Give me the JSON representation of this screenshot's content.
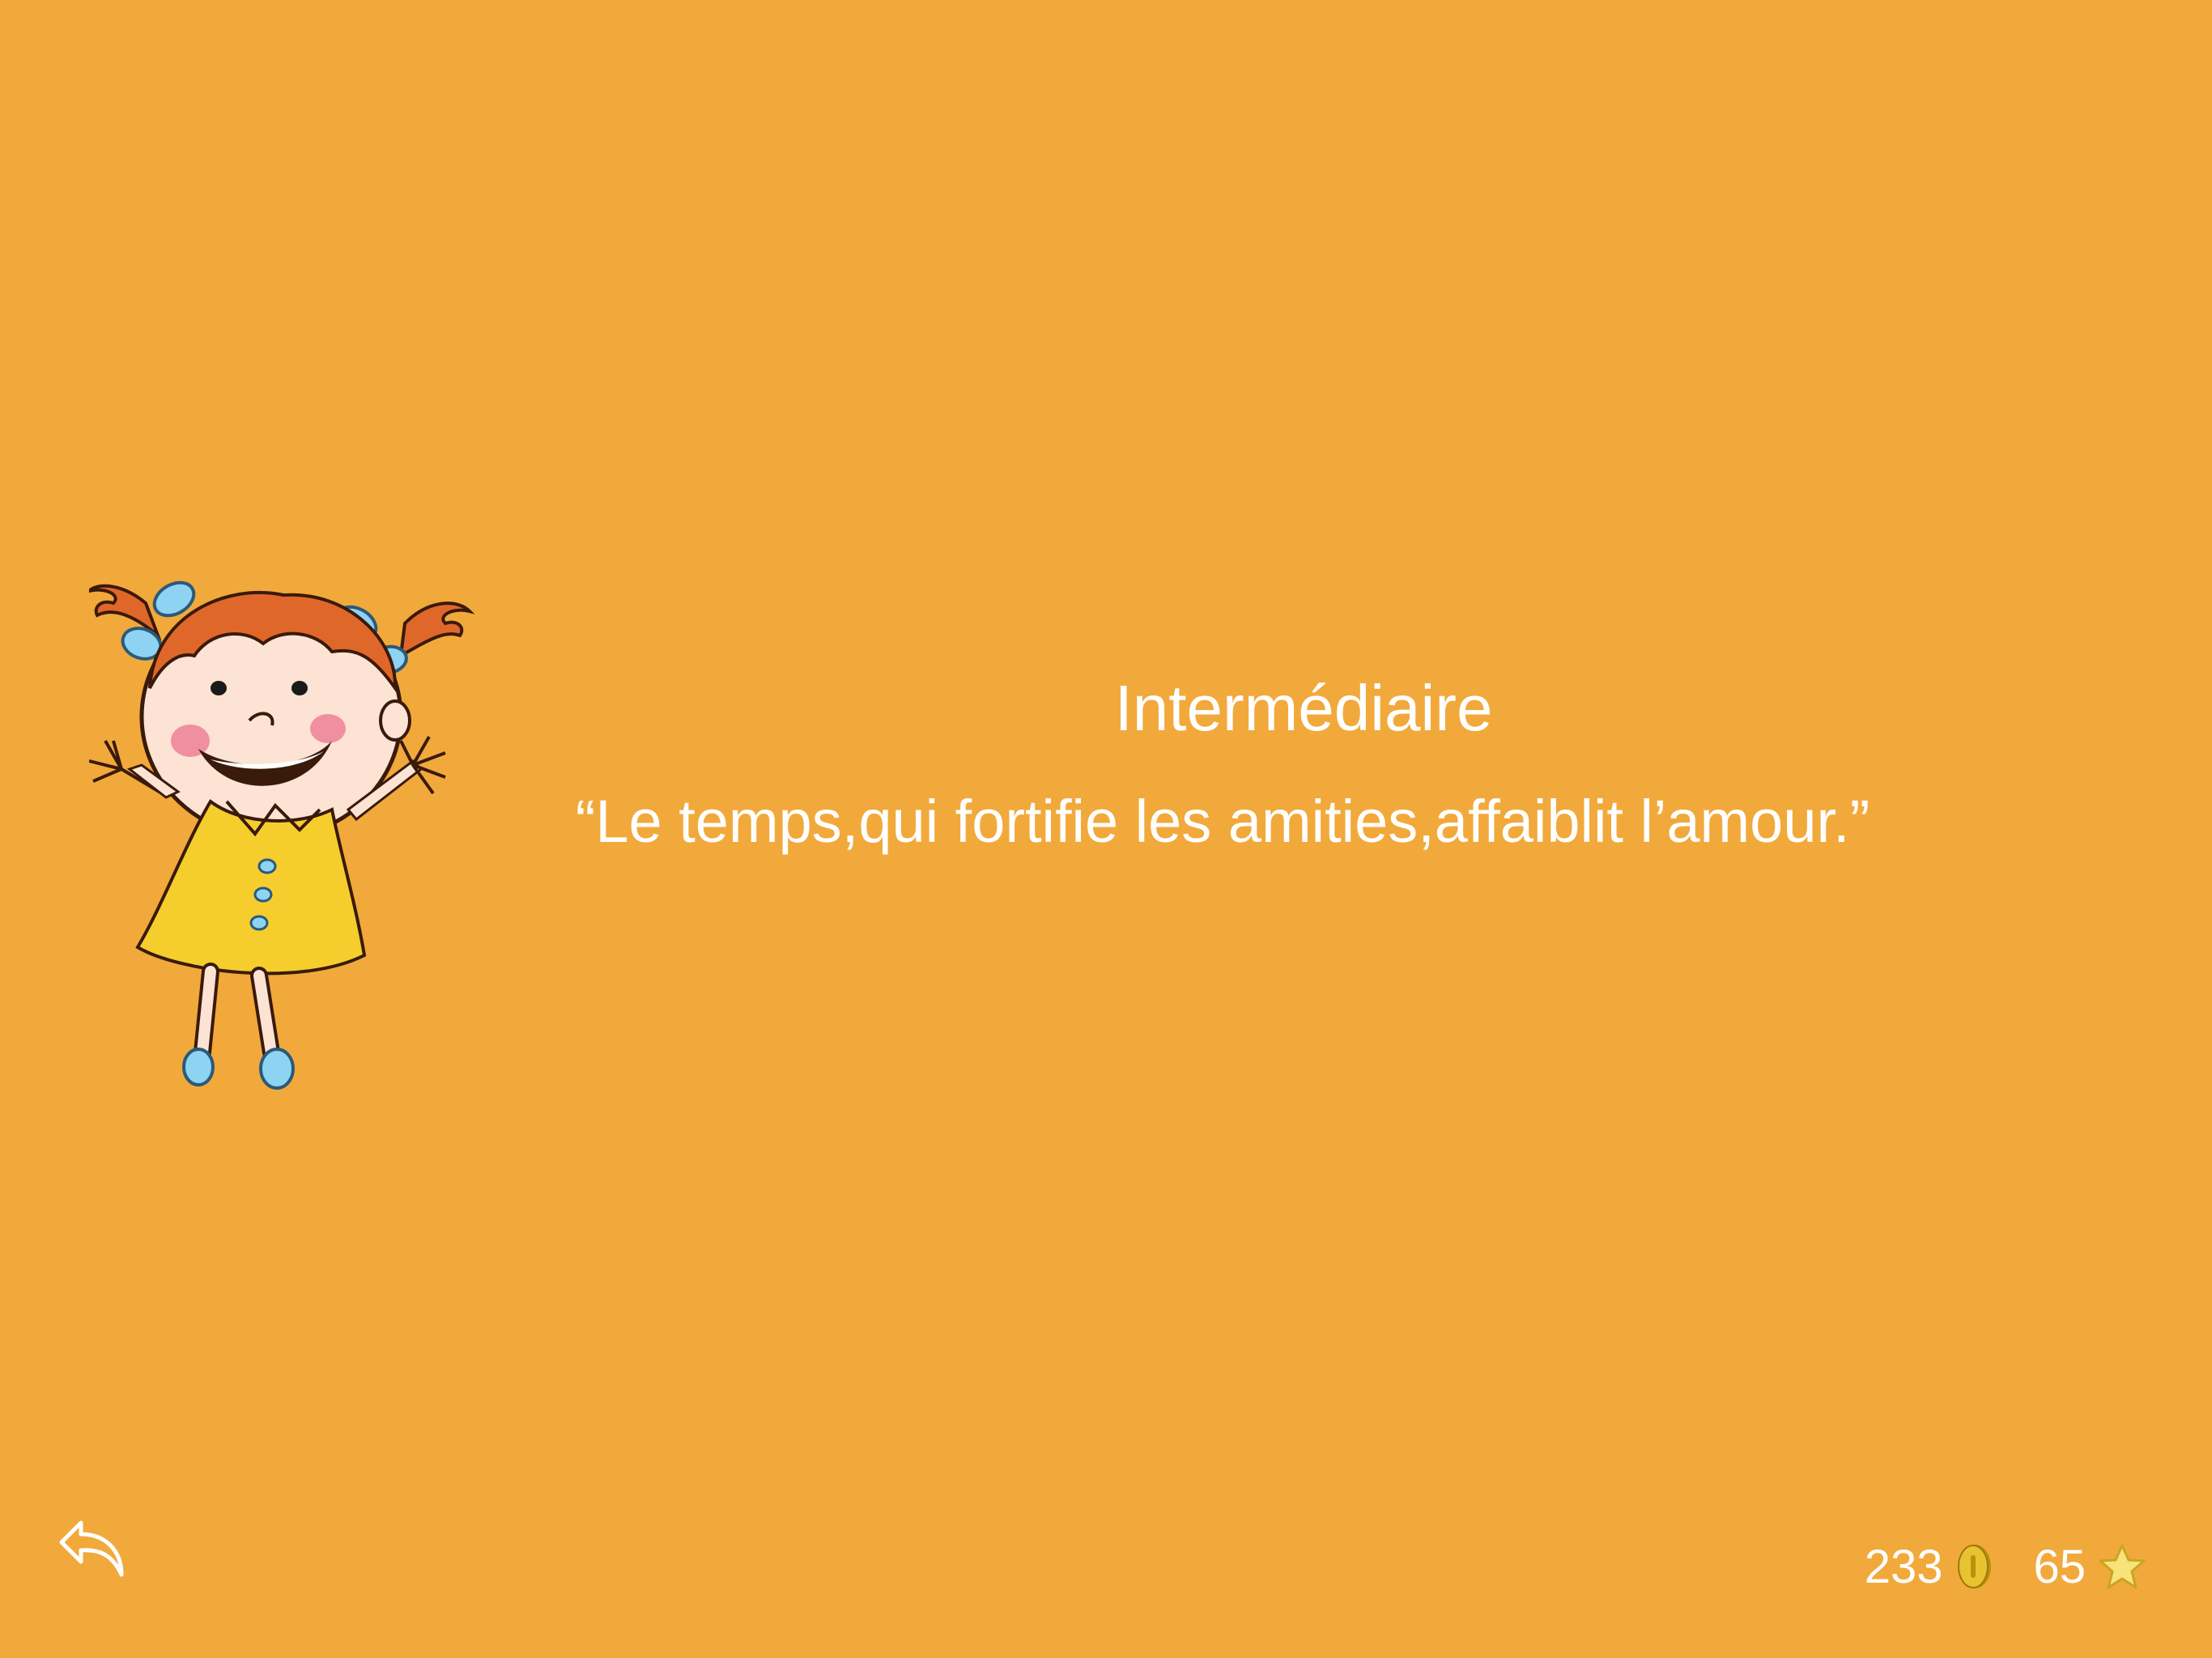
{
  "screen": {
    "background_color": "#F2A93B",
    "level_label": "Intermédiaire",
    "quote": "“Le temps,qui fortifie les amities,affaiblit l’amour.”"
  },
  "illustration": {
    "icon": "cartoon-girl-illustration"
  },
  "toolbar": {
    "back_icon": "back-arrow-icon"
  },
  "stats": {
    "coins": "233",
    "coin_icon": "coin-icon",
    "coin_color": "#D9B21A",
    "stars": "65",
    "star_icon": "star-icon",
    "star_color": "#F8E27A"
  }
}
